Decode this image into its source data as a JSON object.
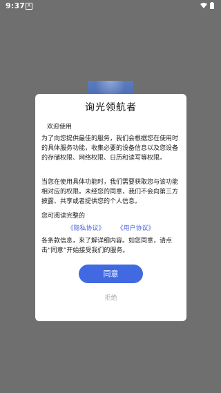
{
  "status_bar": {
    "time": "9:37",
    "notification_glyph": "A",
    "icons": [
      "notification-icon",
      "wifi-icon",
      "battery-icon"
    ]
  },
  "dialog": {
    "title": "询光领航者",
    "welcome": "欢迎使用",
    "para1": "为了向您提供最佳的服务，我们会根据您在使用时的具体服务功能，收集必要的设备信息以及您设备的存储权限、网络权限、日历和读写等权限。",
    "para2": "当您在使用具体功能时，我们需要获取您与该功能相对应的权限。未经您的同意，我们不会向第三方披露、共享或者提供您的个人信息。",
    "read_intro": "您可阅读完整的",
    "privacy_link": "《隐私协议》",
    "user_link": "《用户协议》",
    "para3": "各条款信息，来了解详细内容。如您同意，请点击“同意”开始接受我们的服务。",
    "agree_label": "同意",
    "reject_label": "拒绝"
  },
  "colors": {
    "overlay": "#6f6f6f",
    "primary": "#4169e1",
    "link": "#4a63d4",
    "muted": "#aaaaaa"
  }
}
